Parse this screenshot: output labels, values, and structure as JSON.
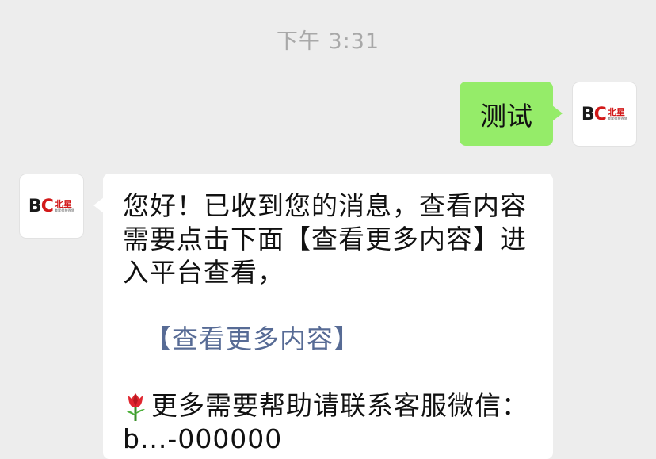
{
  "timestamp": "下午 3:31",
  "self_message": {
    "text": "测试",
    "bubble_color": "#95ec69"
  },
  "avatar_logo": {
    "letters_black": "B",
    "letters_red": "C",
    "cn_name": "北星",
    "tagline": "卖家保护百货"
  },
  "reply_message": {
    "line1": "您好！已收到您的消息，查看内容需要点击下面【查看更多内容】进入平台查看，",
    "link_text": "【查看更多内容】",
    "contact_prefix_icon": "tulip-icon",
    "contact_text": "更多需要帮助请联系客服微信：",
    "wechat_id": "b...-000000"
  },
  "colors": {
    "background": "#ededed",
    "link": "#576b95",
    "brand_red": "#d21a1a"
  }
}
